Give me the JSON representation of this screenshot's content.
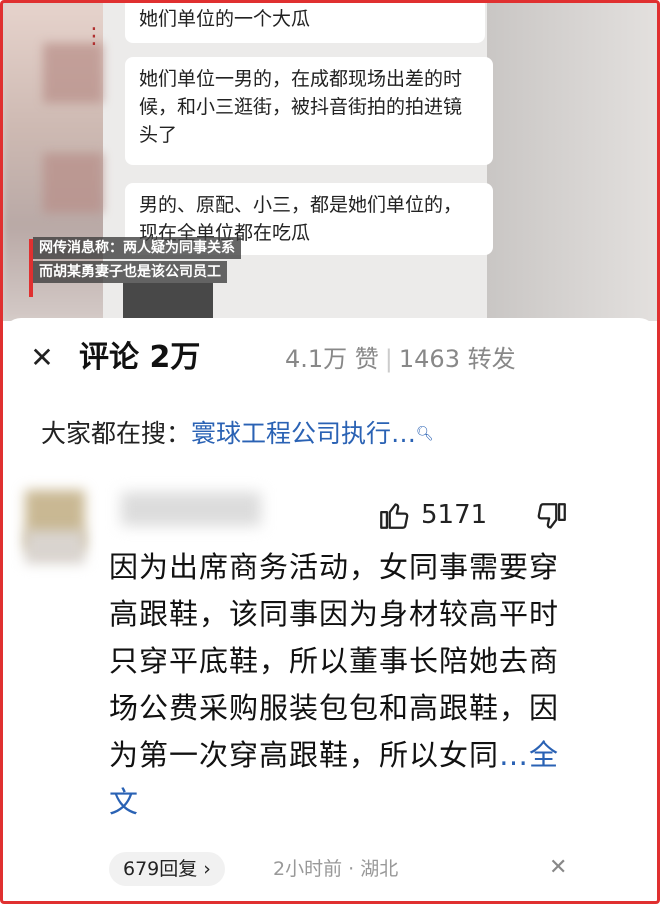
{
  "video": {
    "bubbles": [
      "她们单位的一个大瓜",
      "她们单位一男的，在成都现场出差的时候，和小三逛街，被抖音街拍的拍进镜头了",
      "男的、原配、小三，都是她们单位的，现在全单位都在吃瓜"
    ],
    "captions": [
      "网传消息称：两人疑为同事关系",
      "而胡某勇妻子也是该公司员工"
    ]
  },
  "comments_panel": {
    "close_icon": "close-icon",
    "title": "评论 2万",
    "likes": "4.1万 赞",
    "shares": "1463 转发",
    "search_prefix": "大家都在搜：",
    "search_link": "寰球工程公司执行…"
  },
  "comment": {
    "like_count": "5171",
    "text": "因为出席商务活动，女同事需要穿高跟鞋，该同事因为身材较高平时只穿平底鞋，所以董事长陪她去商场公费采购服装包包和高跟鞋，因为第一次穿高跟鞋，所以女同",
    "more_label": "…全文",
    "replies": "679回复",
    "time_location": "2小时前 · 湖北"
  },
  "colors": {
    "frame": "#e03030",
    "link": "#2a62b4"
  }
}
